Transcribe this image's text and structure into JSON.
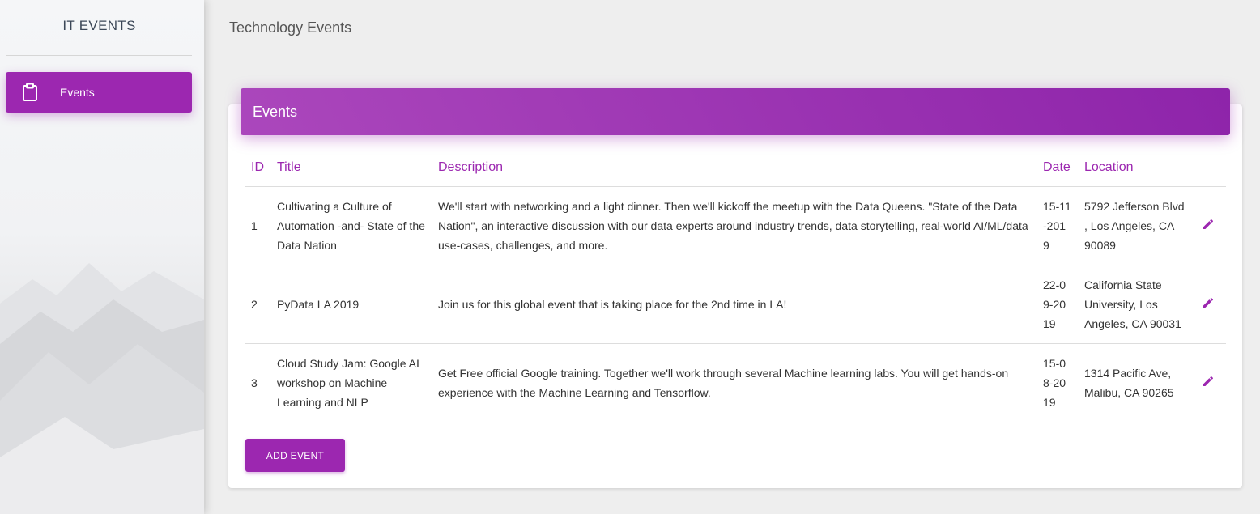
{
  "sidebar": {
    "brand": "IT EVENTS",
    "items": [
      {
        "label": "Events",
        "icon": "clipboard-icon",
        "active": true
      }
    ]
  },
  "page": {
    "title": "Technology Events"
  },
  "card": {
    "title": "Events",
    "columns": [
      "ID",
      "Title",
      "Description",
      "Date",
      "Location"
    ],
    "rows": [
      {
        "id": "1",
        "title": "Cultivating a Culture of Automation -and- State of the Data Nation",
        "description": "We'll start with networking and a light dinner. Then we'll kickoff the meetup with the Data Queens. \"State of the Data Nation\", an interactive discussion with our data experts around industry trends, data storytelling, real-world AI/ML/data use-cases, challenges, and more.",
        "date": "15-11-2019",
        "location": "5792 Jefferson Blvd , Los Angeles, CA 90089"
      },
      {
        "id": "2",
        "title": "PyData LA 2019",
        "description": "Join us for this global event that is taking place for the 2nd time in LA!",
        "date": "22-09-2019",
        "location": "California State University, Los Angeles, CA 90031"
      },
      {
        "id": "3",
        "title": "Cloud Study Jam: Google AI workshop on Machine Learning and NLP",
        "description": "Get Free official Google training. Together we'll work through several Machine learning labs. You will get hands-on experience with the Machine Learning and Tensorflow.",
        "date": "15-08-2019",
        "location": "1314 Pacific Ave, Malibu, CA 90265"
      }
    ],
    "add_button": "ADD EVENT"
  },
  "colors": {
    "accent": "#9c27b0",
    "header_gradient_start": "#ab47bc",
    "header_gradient_end": "#8e24aa"
  },
  "icons": {
    "edit": "pencil-icon"
  }
}
